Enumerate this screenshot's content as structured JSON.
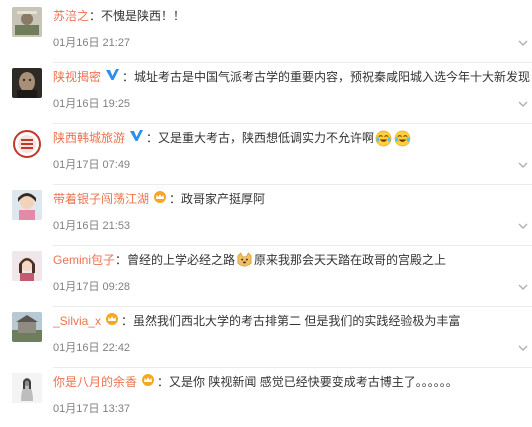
{
  "comments": [
    {
      "user": "苏涪之",
      "badge": "",
      "text": "不愧是陕西！！",
      "text2": "",
      "emoji": "",
      "time": "01月16日 21:27"
    },
    {
      "user": "陕视揭密",
      "badge": "blue-v",
      "text": "城址考古是中国气派考古学的重要内容，预祝秦咸阳城入选今年十大新发现",
      "text2": "",
      "emoji": "",
      "time": "01月16日 19:25"
    },
    {
      "user": "陕西韩城旅游",
      "badge": "blue-v",
      "text": "又是重大考古，陕西想低调实力不允许啊",
      "text2": "",
      "emoji": "laugh-cry-emoji",
      "time": "01月17日 07:49"
    },
    {
      "user": "带着银子闯荡江湖",
      "badge": "gold-crown",
      "text": "政哥家产挺厚阿",
      "text2": "",
      "emoji": "",
      "time": "01月16日 21:53"
    },
    {
      "user": "Gemini包子",
      "badge": "",
      "text": "曾经的上学必经之路",
      "text2": "原来我那会天天踏在政哥的宫殿之上",
      "emoji": "doge-emoji",
      "time": "01月17日 09:28"
    },
    {
      "user": "_Silvia_x",
      "badge": "gold-crown",
      "text": "虽然我们西北大学的考古排第二 但是我们的实践经验极为丰富",
      "text2": "",
      "emoji": "",
      "time": "01月16日 22:42"
    },
    {
      "user": "你是八月的余香",
      "badge": "gold-crown",
      "text": "又是你 陕视新闻 感觉已经快要变成考古博主了。。。。。。",
      "text2": "",
      "emoji": "",
      "time": "01月17日 13:37"
    }
  ],
  "colon": "：",
  "colors": {
    "username": "#eb7350",
    "time": "#808080",
    "verified": "#2d8ef0",
    "crown": "#f5a623"
  }
}
